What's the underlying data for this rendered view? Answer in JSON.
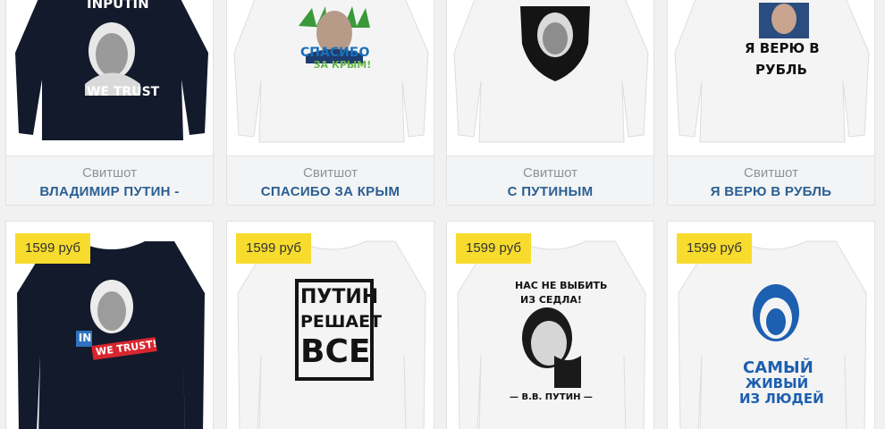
{
  "products_top": [
    {
      "type": "Свитшот",
      "name": "ВЛАДИМИР ПУТИН -",
      "shirt_color": "#131a2c",
      "print_lines": [
        "INPUTIN",
        "WE TRUST"
      ]
    },
    {
      "type": "Свитшот",
      "name": "СПАСИБО ЗА КРЫМ",
      "shirt_color": "#f4f4f4",
      "print_lines": [
        "СПАСИБО",
        "ЗА КРЫМ!"
      ]
    },
    {
      "type": "Свитшот",
      "name": "С ПУТИНЫМ",
      "shirt_color": "#f4f4f4",
      "print_lines": []
    },
    {
      "type": "Свитшот",
      "name": "Я ВЕРЮ В РУБЛЬ",
      "shirt_color": "#f4f4f4",
      "print_lines": [
        "Я ВЕРЮ В",
        "РУБЛЬ"
      ]
    }
  ],
  "products_bottom": [
    {
      "price": "1599 руб",
      "shirt_color": "#131a2c",
      "print_lines": [
        "IN",
        "WE TRUST!"
      ]
    },
    {
      "price": "1599 руб",
      "shirt_color": "#f4f4f4",
      "print_lines": [
        "ПУТИН",
        "РЕШАЕТ",
        "ВСЕ"
      ]
    },
    {
      "price": "1599 руб",
      "shirt_color": "#f4f4f4",
      "print_lines": [
        "НАС НЕ ВЫБИТЬ",
        "ИЗ СЕДЛА!",
        "— В.В. ПУТИН —"
      ]
    },
    {
      "price": "1599 руб",
      "shirt_color": "#f4f4f4",
      "print_lines": [
        "САМЫЙ",
        "ЖИВЫЙ",
        "ИЗ ЛЮДЕЙ"
      ]
    }
  ],
  "colors": {
    "price_badge": "#f7dc2e",
    "product_name": "#2a5f93",
    "product_type": "#8e9296",
    "dark_shirt": "#131a2c",
    "light_shirt": "#f4f4f4"
  }
}
